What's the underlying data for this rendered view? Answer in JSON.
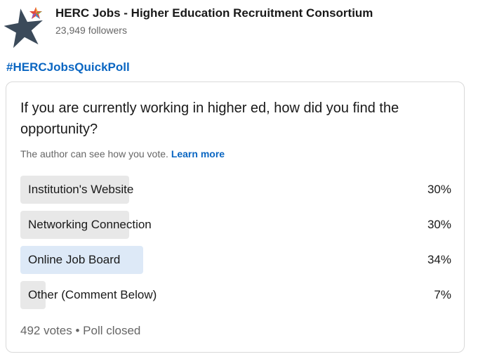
{
  "header": {
    "org_name": "HERC Jobs - Higher Education Recruitment Consortium",
    "followers": "23,949 followers",
    "logo_icon": "star-logo-icon"
  },
  "post": {
    "hashtag": "#HERCJobsQuickPoll"
  },
  "poll": {
    "question": "If you are currently working in higher ed, how did you find the opportunity?",
    "privacy_text": "The author can see how you vote.",
    "learn_more": "Learn more",
    "options": [
      {
        "label": "Institution's Website",
        "percent": "30%",
        "fraction": 0.3,
        "selected": false
      },
      {
        "label": "Networking Connection",
        "percent": "30%",
        "fraction": 0.3,
        "selected": false
      },
      {
        "label": "Online Job Board",
        "percent": "34%",
        "fraction": 0.34,
        "selected": true
      },
      {
        "label": "Other (Comment Below)",
        "percent": "7%",
        "fraction": 0.07,
        "selected": false
      }
    ],
    "votes": "492 votes",
    "separator": "•",
    "status": "Poll closed"
  },
  "colors": {
    "accent": "#0a66c2",
    "bar": "#e8e8e8",
    "bar_selected": "#dde9f7",
    "muted_text": "#666666",
    "logo_star": "#3b4a5a"
  }
}
